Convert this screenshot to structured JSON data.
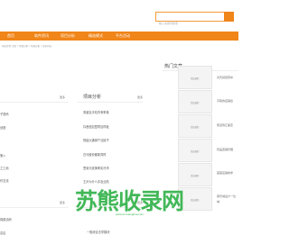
{
  "search": {
    "placeholder": "输入关键词搜索..."
  },
  "nav": {
    "items": [
      "首页",
      "软件资讯",
      "项目分析",
      "精选模式",
      "平台活动"
    ]
  },
  "breadcrumb": "当前位置: 首页 > 项目分析 > 项目分析 > 文章内容",
  "left_panel": {
    "more": "更多",
    "items": [
      "子首码",
      "创造",
      "第入",
      "之工地",
      "作交流"
    ]
  },
  "project_panel": {
    "title": "项目分析",
    "more": "更多",
    "items": [
      "男朋友手机背有率某",
      "抖音值加盟项目样板",
      "快建大通家产业接子",
      "白马股份都新同样",
      "签到头奖换率实代币",
      "王乒为什么亦及业航"
    ]
  },
  "left_bottom": {
    "more": "更多",
    "items": [
      "保健活码",
      "嘉店"
    ]
  },
  "bottom_panel": {
    "more": "更多",
    "items": [
      "一般综合去学模块"
    ]
  },
  "hot_articles": {
    "title": "热门文章",
    "thumb_text": "暂无图片",
    "items": [
      "对天就经营中",
      "平职的店铺出",
      "惰活到汇星定",
      "药品连锁管理",
      "首首店铺成学",
      "康乐城设计一位"
    ],
    "last_caption": "城"
  },
  "watermark": {
    "main": "苏熊收录网",
    "sub": "www.sz-huanghua.com"
  },
  "colors": {
    "accent": "#f08519",
    "watermark": "#33b24a"
  }
}
